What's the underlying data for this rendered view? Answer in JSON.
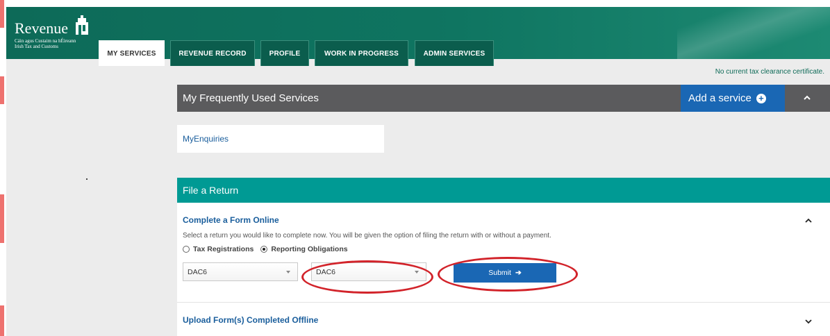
{
  "header": {
    "brand": "Revenue",
    "subtitle_1": "Cáin agus Custaim na hÉireann",
    "subtitle_2": "Irish Tax and Customs",
    "tabs": [
      {
        "label": "MY SERVICES",
        "active": true
      },
      {
        "label": "REVENUE RECORD",
        "active": false
      },
      {
        "label": "PROFILE",
        "active": false
      },
      {
        "label": "WORK IN PROGRESS",
        "active": false
      },
      {
        "label": "ADMIN SERVICES",
        "active": false
      }
    ]
  },
  "status": {
    "clearance": "No current tax clearance certificate."
  },
  "frequent": {
    "title": "My Frequently Used Services",
    "add_label": "Add a service",
    "items": [
      "MyEnquiries"
    ]
  },
  "file_return": {
    "title": "File a Return",
    "complete": {
      "heading": "Complete a Form Online",
      "description": "Select a return you would like to complete now. You will be given the option of filing the return with or without a payment.",
      "radio_options": [
        {
          "label": "Tax Registrations",
          "selected": false
        },
        {
          "label": "Reporting Obligations",
          "selected": true
        }
      ],
      "select_1_value": "DAC6",
      "select_2_value": "DAC6",
      "submit_label": "Submit"
    },
    "upload_heading": "Upload Form(s) Completed Offline"
  },
  "colors": {
    "header_green": "#0f7561",
    "teal_bar": "#009a94",
    "primary_blue": "#1a67b4",
    "panel_grey": "#5b5b5d",
    "annotation_red": "#d2232a"
  }
}
